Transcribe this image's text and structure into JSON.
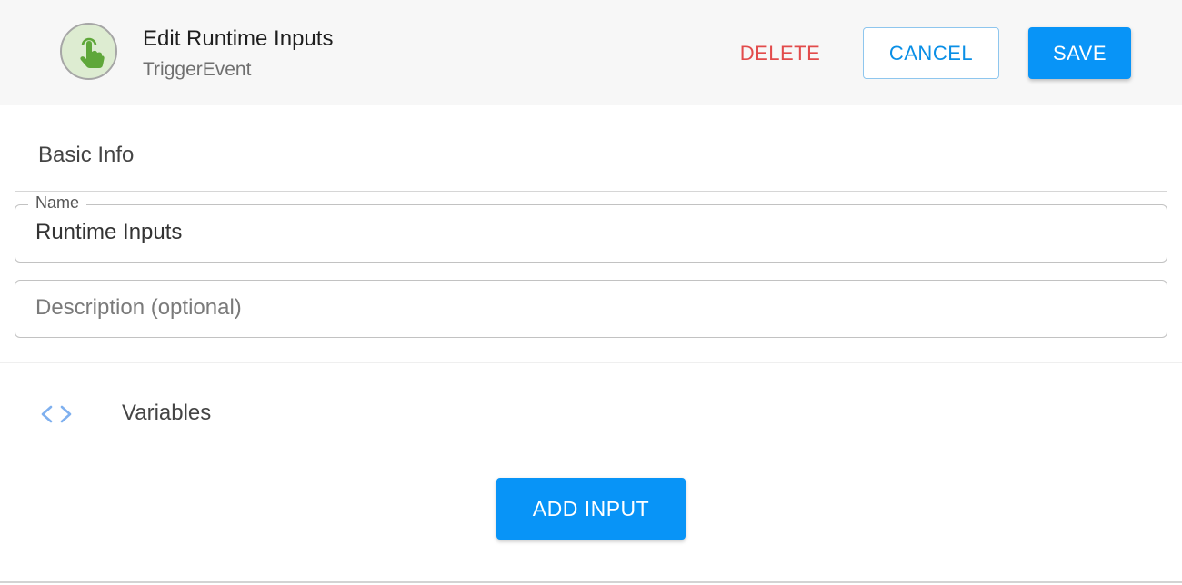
{
  "header": {
    "title": "Edit Runtime Inputs",
    "subtitle": "TriggerEvent",
    "icon": "touch-pointer-icon",
    "delete_label": "DELETE",
    "cancel_label": "CANCEL",
    "save_label": "SAVE"
  },
  "basic_info": {
    "heading": "Basic Info",
    "name_field": {
      "label": "Name",
      "value": "Runtime Inputs"
    },
    "description_field": {
      "placeholder": "Description (optional)",
      "value": ""
    }
  },
  "variables": {
    "icon": "code-brackets-icon",
    "heading": "Variables",
    "add_input_label": "ADD INPUT"
  },
  "colors": {
    "primary": "#0894f7",
    "danger": "#e24b4b",
    "avatar_bg": "#ddecd1",
    "icon_green": "#5fa73a"
  }
}
